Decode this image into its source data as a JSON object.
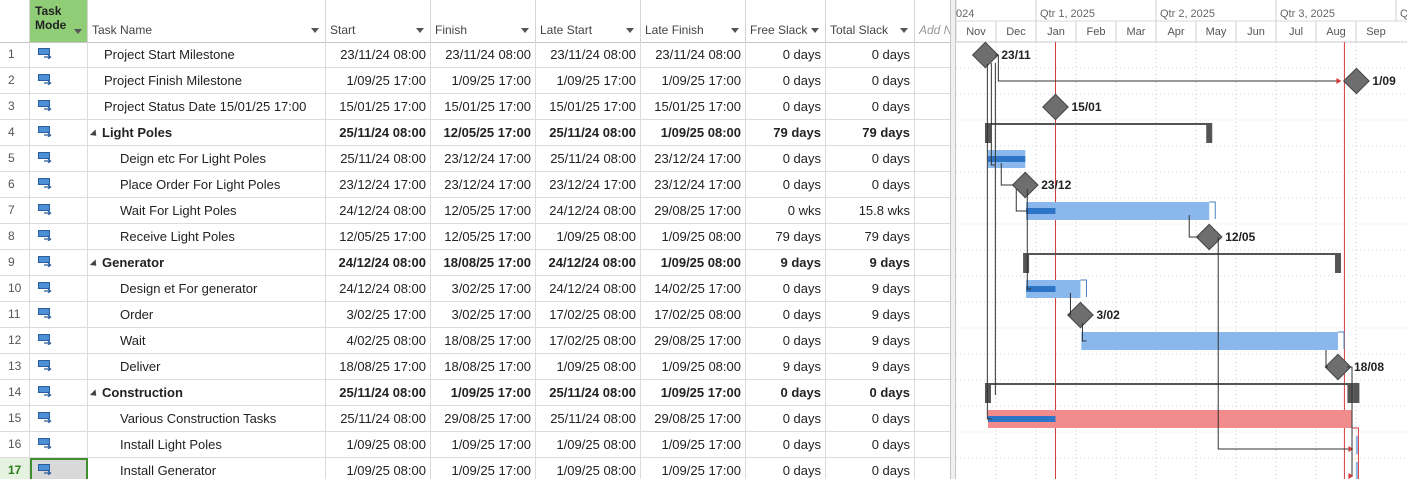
{
  "columns": {
    "mode": "Task Mode",
    "name": "Task Name",
    "start": "Start",
    "finish": "Finish",
    "late_start": "Late Start",
    "late_finish": "Late Finish",
    "free_slack": "Free Slack",
    "total_slack": "Total Slack",
    "add": "Add N"
  },
  "rows": [
    {
      "id": "1",
      "name": "Project Start Milestone",
      "start": "23/11/24 08:00",
      "finish": "23/11/24 08:00",
      "late_start": "23/11/24 08:00",
      "late_finish": "23/11/24 08:00",
      "free_slack": "0 days",
      "total_slack": "0 days",
      "level": 0,
      "summary": false
    },
    {
      "id": "2",
      "name": "Project Finish Milestone",
      "start": "1/09/25 17:00",
      "finish": "1/09/25 17:00",
      "late_start": "1/09/25 17:00",
      "late_finish": "1/09/25 17:00",
      "free_slack": "0 days",
      "total_slack": "0 days",
      "level": 0,
      "summary": false
    },
    {
      "id": "3",
      "name": "Project Status Date 15/01/25 17:00",
      "start": "15/01/25 17:00",
      "finish": "15/01/25 17:00",
      "late_start": "15/01/25 17:00",
      "late_finish": "15/01/25 17:00",
      "free_slack": "0 days",
      "total_slack": "0 days",
      "level": 0,
      "summary": false
    },
    {
      "id": "4",
      "name": "Light Poles",
      "start": "25/11/24 08:00",
      "finish": "12/05/25 17:00",
      "late_start": "25/11/24 08:00",
      "late_finish": "1/09/25 08:00",
      "free_slack": "79 days",
      "total_slack": "79 days",
      "level": 0,
      "summary": true
    },
    {
      "id": "5",
      "name": "Deign etc For Light Poles",
      "start": "25/11/24 08:00",
      "finish": "23/12/24 17:00",
      "late_start": "25/11/24 08:00",
      "late_finish": "23/12/24 17:00",
      "free_slack": "0 days",
      "total_slack": "0 days",
      "level": 1,
      "summary": false
    },
    {
      "id": "6",
      "name": "Place Order For Light Poles",
      "start": "23/12/24 17:00",
      "finish": "23/12/24 17:00",
      "late_start": "23/12/24 17:00",
      "late_finish": "23/12/24 17:00",
      "free_slack": "0 days",
      "total_slack": "0 days",
      "level": 1,
      "summary": false
    },
    {
      "id": "7",
      "name": "Wait For Light Poles",
      "start": "24/12/24 08:00",
      "finish": "12/05/25 17:00",
      "late_start": "24/12/24 08:00",
      "late_finish": "29/08/25 17:00",
      "free_slack": "0 wks",
      "total_slack": "15.8 wks",
      "level": 1,
      "summary": false
    },
    {
      "id": "8",
      "name": "Receive Light Poles",
      "start": "12/05/25 17:00",
      "finish": "12/05/25 17:00",
      "late_start": "1/09/25 08:00",
      "late_finish": "1/09/25 08:00",
      "free_slack": "79 days",
      "total_slack": "79 days",
      "level": 1,
      "summary": false
    },
    {
      "id": "9",
      "name": "Generator",
      "start": "24/12/24 08:00",
      "finish": "18/08/25 17:00",
      "late_start": "24/12/24 08:00",
      "late_finish": "1/09/25 08:00",
      "free_slack": "9 days",
      "total_slack": "9 days",
      "level": 0,
      "summary": true
    },
    {
      "id": "10",
      "name": "Design et For generator",
      "start": "24/12/24 08:00",
      "finish": "3/02/25 17:00",
      "late_start": "24/12/24 08:00",
      "late_finish": "14/02/25 17:00",
      "free_slack": "0 days",
      "total_slack": "9 days",
      "level": 1,
      "summary": false
    },
    {
      "id": "11",
      "name": "Order",
      "start": "3/02/25 17:00",
      "finish": "3/02/25 17:00",
      "late_start": "17/02/25 08:00",
      "late_finish": "17/02/25 08:00",
      "free_slack": "0 days",
      "total_slack": "9 days",
      "level": 1,
      "summary": false
    },
    {
      "id": "12",
      "name": "Wait",
      "start": "4/02/25 08:00",
      "finish": "18/08/25 17:00",
      "late_start": "17/02/25 08:00",
      "late_finish": "29/08/25 17:00",
      "free_slack": "0 days",
      "total_slack": "9 days",
      "level": 1,
      "summary": false
    },
    {
      "id": "13",
      "name": "Deliver",
      "start": "18/08/25 17:00",
      "finish": "18/08/25 17:00",
      "late_start": "1/09/25 08:00",
      "late_finish": "1/09/25 08:00",
      "free_slack": "9 days",
      "total_slack": "9 days",
      "level": 1,
      "summary": false
    },
    {
      "id": "14",
      "name": "Construction",
      "start": "25/11/24 08:00",
      "finish": "1/09/25 17:00",
      "late_start": "25/11/24 08:00",
      "late_finish": "1/09/25 17:00",
      "free_slack": "0 days",
      "total_slack": "0 days",
      "level": 0,
      "summary": true
    },
    {
      "id": "15",
      "name": "Various Construction Tasks",
      "start": "25/11/24 08:00",
      "finish": "29/08/25 17:00",
      "late_start": "25/11/24 08:00",
      "late_finish": "29/08/25 17:00",
      "free_slack": "0 days",
      "total_slack": "0 days",
      "level": 1,
      "summary": false
    },
    {
      "id": "16",
      "name": "Install Light Poles",
      "start": "1/09/25 08:00",
      "finish": "1/09/25 17:00",
      "late_start": "1/09/25 08:00",
      "late_finish": "1/09/25 17:00",
      "free_slack": "0 days",
      "total_slack": "0 days",
      "level": 1,
      "summary": false
    },
    {
      "id": "17",
      "name": "Install Generator",
      "start": "1/09/25 08:00",
      "finish": "1/09/25 17:00",
      "late_start": "1/09/25 08:00",
      "late_finish": "1/09/25 17:00",
      "free_slack": "0 days",
      "total_slack": "0 days",
      "level": 1,
      "summary": false,
      "selected": true
    }
  ],
  "gantt": {
    "quarters": [
      "024",
      "Qtr 1, 2025",
      "Qtr 2, 2025",
      "Qtr 3, 2025",
      "Q"
    ],
    "months": [
      "Nov",
      "Dec",
      "Jan",
      "Feb",
      "Mar",
      "Apr",
      "May",
      "Jun",
      "Jul",
      "Aug",
      "Sep"
    ],
    "milestone_labels": {
      "1": "23/11",
      "2": "1/09",
      "3": "15/01",
      "6": "23/12",
      "8": "12/05",
      "11": "3/02",
      "13": "18/08"
    },
    "colors": {
      "bar": "#8ab8ec",
      "progress": "#2f75c7",
      "critical": "#f28b8b",
      "summary": "#555555",
      "milestone": "#6e6e6e",
      "status_line": "#d23c3c",
      "mode_green": "#8fce76"
    }
  }
}
